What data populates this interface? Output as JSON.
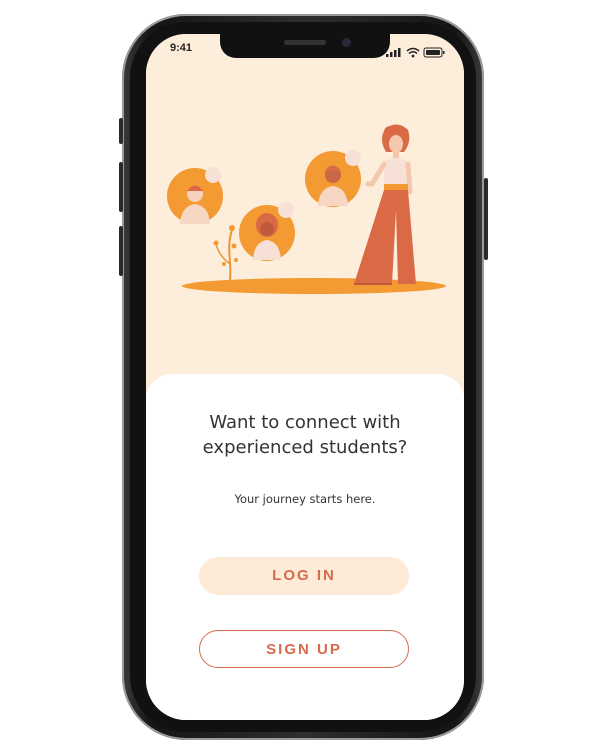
{
  "status_bar": {
    "time": "9:41"
  },
  "onboarding": {
    "headline_line1": "Want to connect with",
    "headline_line2": "experienced students?",
    "subtitle": "Your journey starts here."
  },
  "actions": {
    "login_label": "LOG IN",
    "signup_label": "SIGN UP"
  },
  "colors": {
    "accent": "#d76a4c",
    "hero_background": "#fdeddb",
    "illustration_orange": "#f39a32",
    "login_button_background": "#fdebd7"
  },
  "icons": {
    "status": [
      "signal-icon",
      "wifi-icon",
      "battery-icon"
    ],
    "illustration": "people-network-illustration"
  }
}
